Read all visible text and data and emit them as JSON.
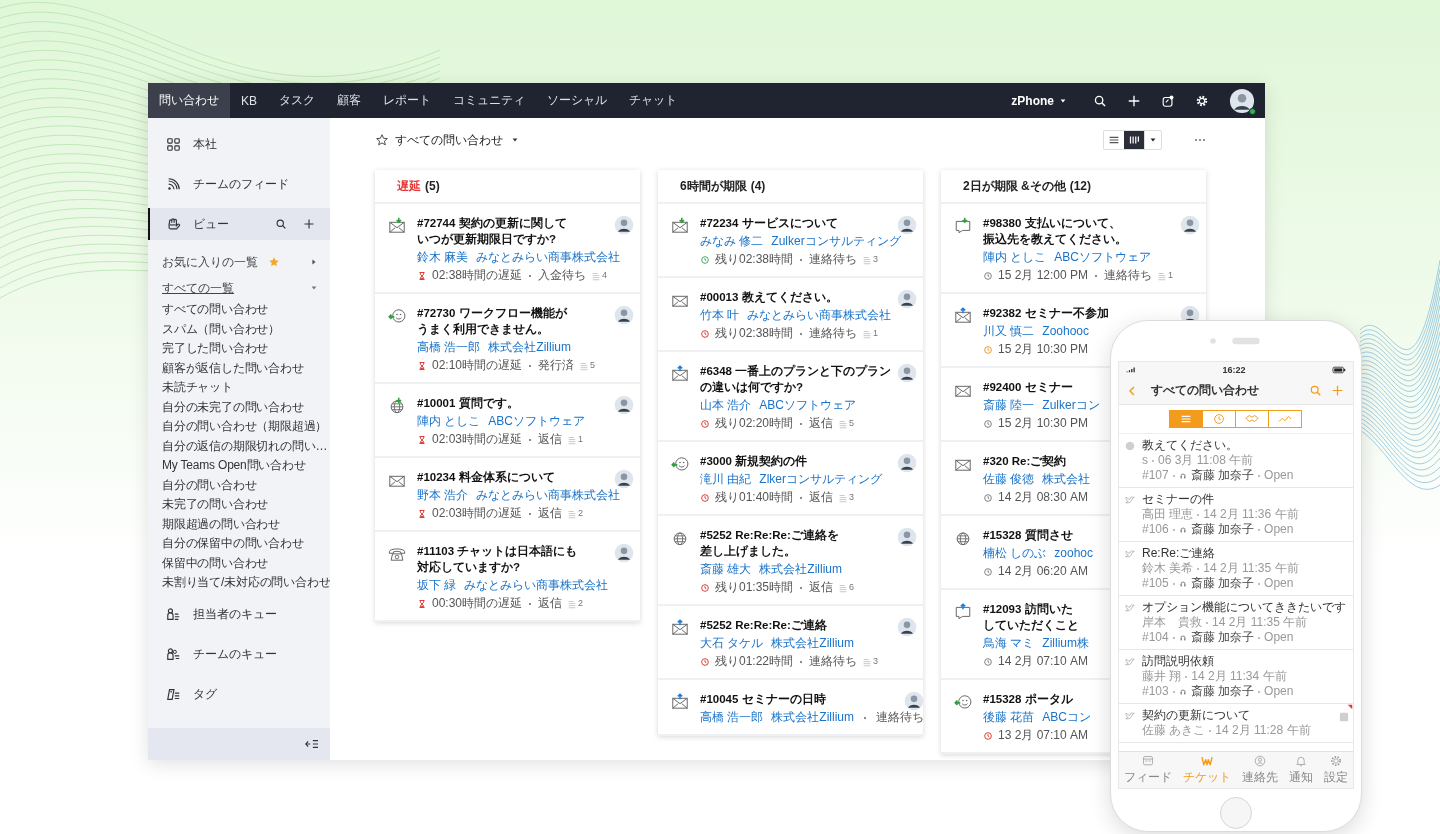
{
  "top_nav": {
    "tabs": [
      {
        "label": "問い合わせ",
        "selected": true
      },
      {
        "label": "KB",
        "selected": false
      },
      {
        "label": "タスク",
        "selected": false
      },
      {
        "label": "顧客",
        "selected": false
      },
      {
        "label": "レポート",
        "selected": false
      },
      {
        "label": "コミュニティ",
        "selected": false
      },
      {
        "label": "ソーシャル",
        "selected": false
      },
      {
        "label": "チャット",
        "selected": false
      }
    ],
    "department": "zPhone"
  },
  "sidebar": {
    "items": [
      {
        "label": "本社",
        "kind": "grid",
        "selected": false
      },
      {
        "label": "チームのフィード",
        "kind": "feed",
        "selected": false
      },
      {
        "label": "ビュー",
        "kind": "hand",
        "selected": true
      }
    ],
    "favorites": {
      "label": "お気に入りの一覧",
      "expanded": false
    },
    "all_lists": {
      "label": "すべての一覧",
      "expanded": true
    },
    "views": [
      "すべての問い合わせ",
      "スパム（問い合わせ）",
      "完了した問い合わせ",
      "顧客が返信した問い合わせ",
      "未読チャット",
      "自分の未完了の問い合わせ",
      "自分の問い合わせ（期限超過）",
      "自分の返信の期限切れの問い…",
      "My Teams Open問い合わせ",
      "自分の問い合わせ",
      "未完了の問い合わせ",
      "期限超過の問い合わせ",
      "自分の保留中の問い合わせ",
      "保留中の問い合わせ",
      "未割り当て/未対応の問い合わせ"
    ],
    "bottom_items": [
      {
        "label": "担当者のキュー",
        "kind": "person_queue"
      },
      {
        "label": "チームのキュー",
        "kind": "team_queue"
      },
      {
        "label": "タグ",
        "kind": "tag"
      }
    ]
  },
  "toolbar": {
    "view_title": "すべての問い合わせ",
    "layout_buttons": [
      {
        "kind": "list",
        "selected": false
      },
      {
        "kind": "kanban",
        "selected": true
      }
    ]
  },
  "columns": [
    {
      "label": "遅延",
      "count": "(5)",
      "color": "#e53935",
      "cards": [
        {
          "kind": "mail_in",
          "title_lines": [
            "#72744 契約の更新に関して",
            "いつが更新期限日ですか?"
          ],
          "contact": "鈴木 麻美",
          "account": "みなとみらい商事株式会社",
          "due": {
            "kind": "overdue",
            "text": "02:38時間の遅延"
          },
          "status": "入金待ち",
          "threads": "4",
          "photo": true
        },
        {
          "kind": "feedback_in",
          "title_lines": [
            "#72730 ワークフロー機能が",
            "うまく利用できません。"
          ],
          "contact": "高橋 浩一郎",
          "account": "株式会社Zillium",
          "due": {
            "kind": "overdue",
            "text": "02:10時間の遅延"
          },
          "status": "発行済",
          "threads": "5",
          "photo": true
        },
        {
          "kind": "web_in",
          "title_lines": [
            "#10001 質問です。"
          ],
          "contact": "陣内 としこ",
          "account": "ABCソフトウェア",
          "due": {
            "kind": "overdue",
            "text": "02:03時間の遅延"
          },
          "status": "返信",
          "threads": "1",
          "photo": true
        },
        {
          "kind": "mail",
          "title_lines": [
            "#10234 料金体系について"
          ],
          "contact": "野本 浩介",
          "account": "みなとみらい商事株式会社",
          "due": {
            "kind": "overdue",
            "text": "02:03時間の遅延"
          },
          "status": "返信",
          "threads": "2",
          "photo": true
        },
        {
          "kind": "phone",
          "title_lines": [
            "#11103 チャットは日本語にも",
            "対応していますか?"
          ],
          "contact": "坂下 緑",
          "account": "みなとみらい商事株式会社",
          "due": {
            "kind": "overdue",
            "text": "00:30時間の遅延"
          },
          "status": "返信",
          "threads": "2",
          "photo": true
        }
      ]
    },
    {
      "label": "6時間が期限",
      "count": "(4)",
      "color": "#222222",
      "cards": [
        {
          "kind": "mail_in",
          "title_lines": [
            "#72234 サービスについて"
          ],
          "contact": "みなみ 修二",
          "account": "Zulkerコンサルティング",
          "due": {
            "kind": "remaining_green",
            "text": "残り02:38時間"
          },
          "status": "連絡待ち",
          "threads": "3",
          "photo": true
        },
        {
          "kind": "mail",
          "title_lines": [
            "#00013 教えてください。"
          ],
          "contact": "竹本 叶",
          "account": "みなとみらい商事株式会社",
          "due": {
            "kind": "remaining_red",
            "text": "残り02:38時間"
          },
          "status": "連絡待ち",
          "threads": "1",
          "photo": true
        },
        {
          "kind": "mail_out",
          "title_lines": [
            "#6348 一番上のプランと下のプラン",
            "の違いは何ですか?"
          ],
          "contact": "山本 浩介",
          "account": "ABCソフトウェア",
          "due": {
            "kind": "remaining_red",
            "text": "残り02:20時間"
          },
          "status": "返信",
          "threads": "5",
          "photo": true
        },
        {
          "kind": "feedback_in",
          "title_lines": [
            "#3000 新規契約の件"
          ],
          "contact": "滝川 由紀",
          "account": "Zlkerコンサルティング",
          "due": {
            "kind": "remaining_red",
            "text": "残り01:40時間"
          },
          "status": "返信",
          "threads": "3",
          "photo": true
        },
        {
          "kind": "web",
          "title_lines": [
            "#5252 Re:Re:Re:ご連絡を",
            "差し上げました。"
          ],
          "contact": "斎藤 雄大",
          "account": "株式会社Zillium",
          "due": {
            "kind": "remaining_red",
            "text": "残り01:35時間"
          },
          "status": "返信",
          "threads": "6",
          "photo": true
        },
        {
          "kind": "mail_out",
          "title_lines": [
            "#5252 Re:Re:Re:ご連絡"
          ],
          "contact": "大石 タケル",
          "account": "株式会社Zillium",
          "due": {
            "kind": "remaining_red",
            "text": "残り01:22時間"
          },
          "status": "連絡待ち",
          "threads": "3",
          "photo": true
        },
        {
          "kind": "mail_out",
          "title_lines": [
            "#10045 セミナーの日時"
          ],
          "contact": "高橋 浩一郎",
          "account": "株式会社Zillium",
          "status": "連絡待ち",
          "photo": true
        }
      ]
    },
    {
      "label": "2日が期限 &その他",
      "count": "(12)",
      "color": "#222222",
      "cards": [
        {
          "kind": "chat_in",
          "title_lines": [
            "#98380 支払いについて、",
            "振込先を教えてください。"
          ],
          "contact": "陣内 としこ",
          "account": "ABCソフトウェア",
          "due": {
            "kind": "date",
            "text": "15 2月 12:00 PM"
          },
          "status": "連絡待ち",
          "threads": "1",
          "photo": true
        },
        {
          "kind": "mail_out",
          "title_lines": [
            "#92382 セミナー不参加"
          ],
          "contact": "川又 慎二",
          "account": "Zoohooc",
          "due": {
            "kind": "date_orange",
            "text": "15 2月 10:30 PM"
          },
          "photo": true
        },
        {
          "kind": "mail",
          "title_lines": [
            "#92400 セミナー"
          ],
          "contact": "斎藤 陸一",
          "account": "Zulkerコン",
          "due": {
            "kind": "date",
            "text": "15 2月 10:30 PM"
          },
          "photo": false
        },
        {
          "kind": "mail",
          "title_lines": [
            "#320 Re:ご契約"
          ],
          "contact": "佐藤 俊徳",
          "account": "株式会社",
          "due": {
            "kind": "date",
            "text": "14 2月 08:30 AM"
          },
          "photo": false
        },
        {
          "kind": "web",
          "title_lines": [
            "#15328 質問させ"
          ],
          "contact": "楠松 しのぶ",
          "account": "zoohoc",
          "due": {
            "kind": "date",
            "text": "14 2月 06:20 AM"
          },
          "photo": false
        },
        {
          "kind": "chat_out",
          "title_lines": [
            "#12093 訪問いた",
            "していただくこと"
          ],
          "contact": "鳥海 マミ",
          "account": "Zillium株",
          "due": {
            "kind": "date",
            "text": "14 2月 07:10 AM"
          },
          "photo": false
        },
        {
          "kind": "feedback_in",
          "title_lines": [
            "#15328 ポータル"
          ],
          "contact": "後藤 花苗",
          "account": "ABCコン",
          "due": {
            "kind": "date_red",
            "text": "13 2月 07:10 AM"
          },
          "photo": false
        }
      ]
    }
  ],
  "phone": {
    "time": "16:22",
    "title": "すべての問い合わせ",
    "segments": [
      {
        "kind": "list",
        "selected": true
      },
      {
        "kind": "clock",
        "selected": false
      },
      {
        "kind": "handshake",
        "selected": false
      },
      {
        "kind": "trend",
        "selected": false
      }
    ],
    "tickets": [
      {
        "kind": "web",
        "title": "教えてください。",
        "author": "s",
        "time": "06 3月 11:08 午前",
        "number": "#107",
        "agent": "斎藤 加奈子",
        "status": "Open",
        "flagged": false
      },
      {
        "kind": "social",
        "title": "セミナーの件",
        "author": "高田 理恵",
        "time": "14 2月 11:36 午前",
        "number": "#106",
        "agent": "斎藤 加奈子",
        "status": "Open",
        "flagged": false
      },
      {
        "kind": "social",
        "title": "Re:Re:ご連絡",
        "author": "鈴木 美希",
        "time": "14 2月 11:35 午前",
        "number": "#105",
        "agent": "斎藤 加奈子",
        "status": "Open",
        "flagged": false
      },
      {
        "kind": "social",
        "title": "オプション機能についてききたいです",
        "author": "岸本　貴救",
        "time": "14 2月 11:35 午前",
        "number": "#104",
        "agent": "斎藤 加奈子",
        "status": "Open",
        "flagged": false
      },
      {
        "kind": "social",
        "title": "訪問説明依頼",
        "author": "藤井 翔",
        "time": "14 2月 11:34 午前",
        "number": "#103",
        "agent": "斎藤 加奈子",
        "status": "Open",
        "flagged": false
      },
      {
        "kind": "social",
        "title": "契約の更新について",
        "author": "佐藤 あきこ",
        "time": "14 2月 11:28 午前",
        "flagged": true
      }
    ],
    "tabs": [
      {
        "label": "フィード",
        "kind": "feed",
        "selected": false
      },
      {
        "label": "チケット",
        "kind": "ticket",
        "selected": true
      },
      {
        "label": "連絡先",
        "kind": "contact",
        "selected": false
      },
      {
        "label": "通知",
        "kind": "bell",
        "selected": false
      },
      {
        "label": "設定",
        "kind": "gear",
        "selected": false
      }
    ]
  }
}
